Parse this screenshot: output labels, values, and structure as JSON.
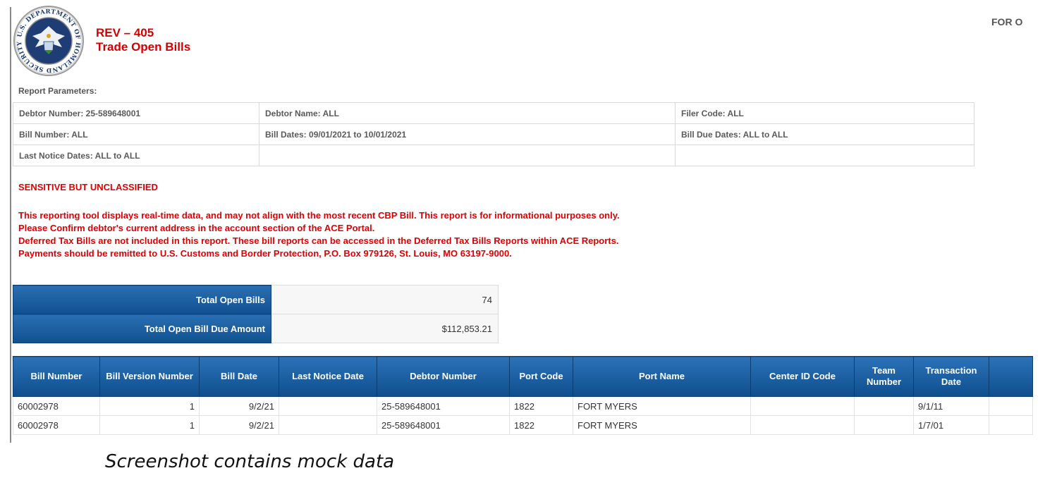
{
  "header": {
    "seal_text": "U.S. DEPARTMENT OF HOMELAND SECURITY",
    "report_code": "REV – 405",
    "report_title": "Trade Open Bills",
    "classification_corner": "FOR O"
  },
  "parameters": {
    "label": "Report Parameters:",
    "rows": [
      [
        "Debtor Number: 25-589648001",
        "Debtor Name: ALL",
        "Filer Code: ALL"
      ],
      [
        "Bill Number: ALL",
        "Bill Dates:  09/01/2021 to 10/01/2021",
        "Bill Due Dates:  ALL to ALL"
      ],
      [
        "Last Notice Dates:  ALL to ALL",
        "",
        ""
      ]
    ]
  },
  "classification": "SENSITIVE BUT UNCLASSIFIED",
  "notices": [
    "This reporting tool displays real-time data, and may not align with the most recent CBP Bill. This report is for informational purposes only.",
    "Please Confirm debtor's current address in the account section of the ACE Portal.",
    "Deferred Tax Bills are not included in this report.  These bill reports can be accessed in the Deferred Tax Bills Reports within ACE Reports.",
    "Payments should be remitted to U.S. Customs and Border Protection, P.O. Box 979126, St. Louis, MO 63197-9000."
  ],
  "totals": {
    "open_bills_label": "Total Open Bills",
    "open_bills_value": "74",
    "due_amount_label": "Total Open Bill Due Amount",
    "due_amount_value": "$112,853.21"
  },
  "bills_table": {
    "columns": [
      "Bill Number",
      "Bill Version Number",
      "Bill Date",
      "Last Notice Date",
      "Debtor Number",
      "Port Code",
      "Port Name",
      "Center ID Code",
      "Team Number",
      "Transaction Date"
    ],
    "rows": [
      [
        "60002978",
        "1",
        "9/2/21",
        "",
        "25-589648001",
        "1822",
        "FORT MYERS",
        "",
        "",
        "9/1/11"
      ],
      [
        "60002978",
        "1",
        "9/2/21",
        "",
        "25-589648001",
        "1822",
        "FORT MYERS",
        "",
        "",
        "1/7/01"
      ]
    ]
  },
  "footer_note": "Screenshot contains mock data",
  "colors": {
    "alert_red": "#e00000",
    "title_red": "#d40000",
    "header_blue": "#1a5e9f"
  }
}
